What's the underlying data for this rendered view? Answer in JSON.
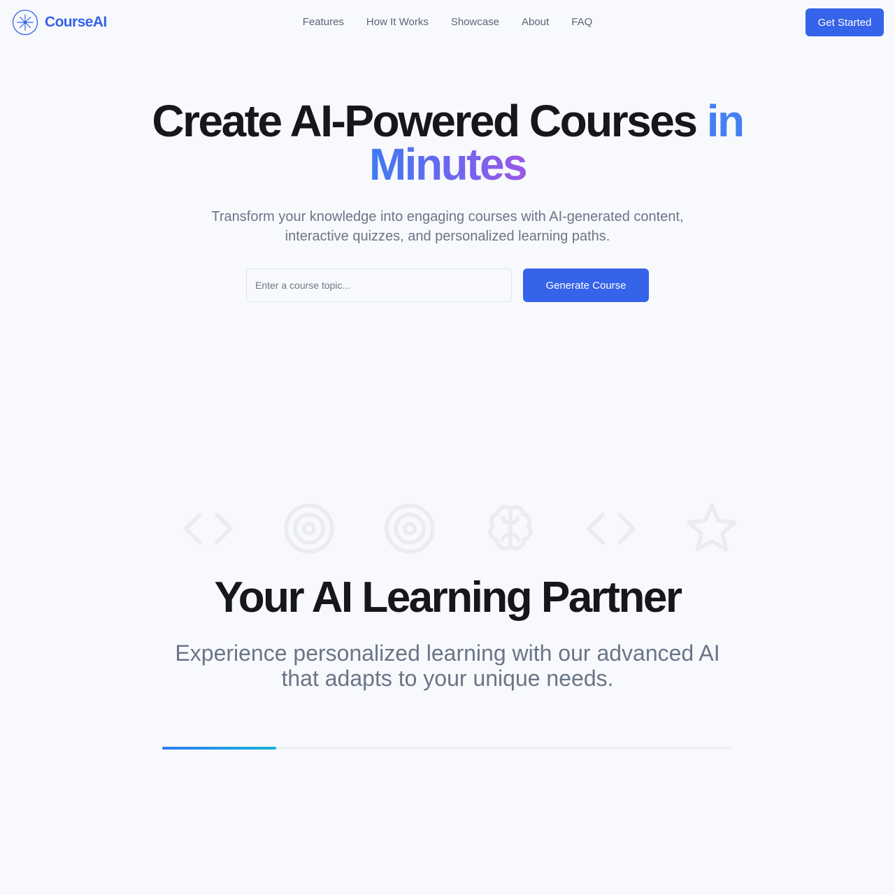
{
  "header": {
    "brand": "CourseAI",
    "logo_icon": "compass-sparkle-icon",
    "nav": [
      "Features",
      "How It Works",
      "Showcase",
      "About",
      "FAQ"
    ],
    "cta": "Get Started"
  },
  "hero": {
    "title_main": "Create AI-Powered Courses ",
    "title_accent_1": "in",
    "title_accent_2": "Minutes",
    "subtitle": "Transform your knowledge into engaging courses with AI-generated content, interactive quizzes, and personalized learning paths.",
    "input_placeholder": "Enter a course topic...",
    "input_value": "",
    "button": "Generate Course"
  },
  "feature_icons": [
    "code-icon",
    "target-icon",
    "target-icon",
    "brain-icon",
    "code-icon",
    "star-icon"
  ],
  "partner": {
    "title": "Your AI Learning Partner",
    "subtitle": "Experience personalized learning with our advanced AI that adapts to your unique needs.",
    "progress_percent": 20
  },
  "colors": {
    "brand": "#3563e9",
    "accent_blue": "#4680f0",
    "accent_purple": "#9a58e6",
    "muted_text": "#6b7588",
    "background": "#f7f9fc"
  }
}
